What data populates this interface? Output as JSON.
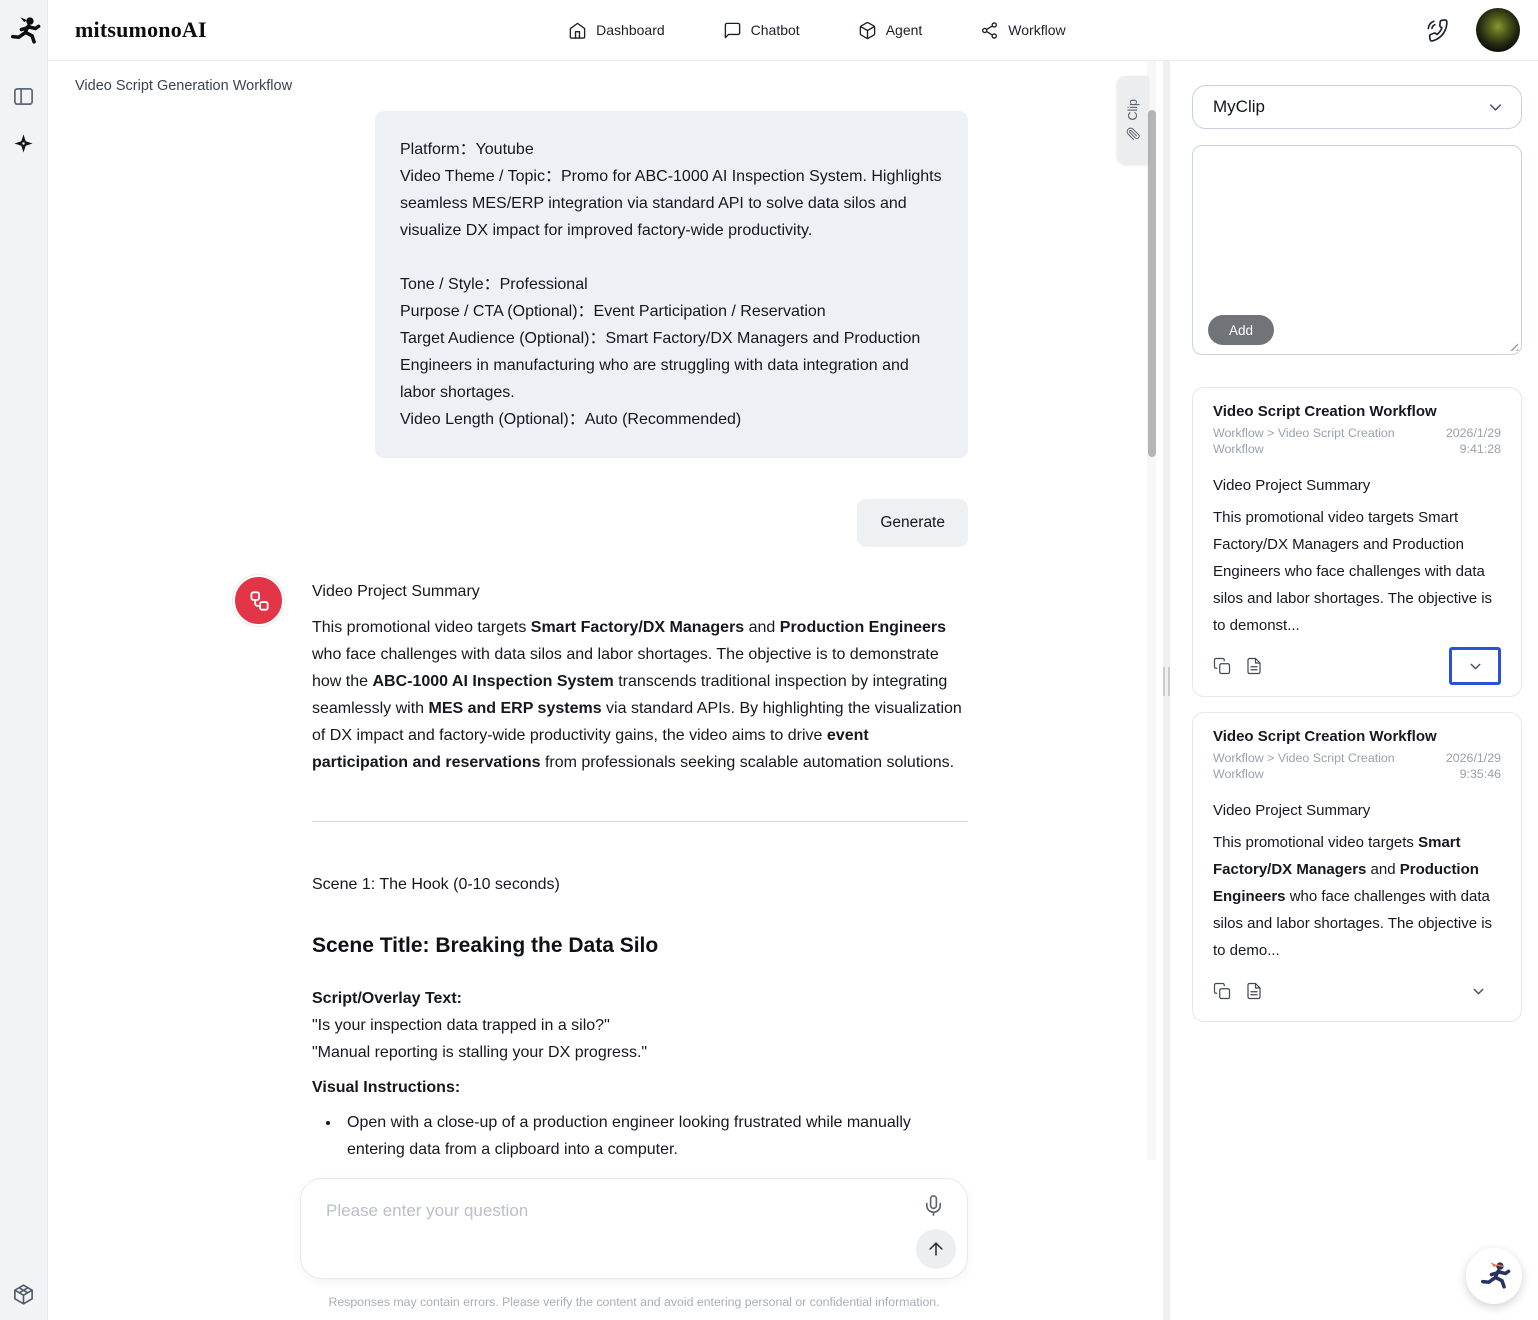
{
  "brand": {
    "name": "mitsumonoAI"
  },
  "nav": {
    "items": [
      {
        "label": "Dashboard",
        "icon": "home-icon"
      },
      {
        "label": "Chatbot",
        "icon": "chat-bubble-icon"
      },
      {
        "label": "Agent",
        "icon": "package-box-icon"
      },
      {
        "label": "Workflow",
        "icon": "share-nodes-icon"
      }
    ]
  },
  "main": {
    "page_title": "Video Script Generation Workflow",
    "user_message": "Platform：Youtube\nVideo Theme / Topic：Promo for ABC-1000 AI Inspection System. Highlights seamless MES/ERP integration via standard API to solve data silos and visualize DX impact for improved factory-wide productivity.\n\nTone / Style：Professional\nPurpose / CTA (Optional)：Event Participation / Reservation\nTarget Audience (Optional)：Smart Factory/DX Managers and Production Engineers in manufacturing who are struggling with data integration and labor shortages.\nVideo Length (Optional)：Auto (Recommended)",
    "generate_label": "Generate",
    "assistant": {
      "summary_title": "Video Project Summary",
      "summary_segments": [
        {
          "t": "This promotional video targets "
        },
        {
          "t": "Smart Factory/DX Managers",
          "b": true
        },
        {
          "t": " and "
        },
        {
          "t": "Production Engineers",
          "b": true
        },
        {
          "t": " who face challenges with data silos and labor shortages. The objective is to demonstrate how the "
        },
        {
          "t": "ABC-1000 AI Inspection System",
          "b": true
        },
        {
          "t": " transcends traditional inspection by integrating seamlessly with "
        },
        {
          "t": "MES and ERP systems",
          "b": true
        },
        {
          "t": " via standard APIs. By highlighting the visualization of DX impact and factory-wide productivity gains, the video aims to drive "
        },
        {
          "t": "event participation and reservations",
          "b": true
        },
        {
          "t": " from professionals seeking scalable automation solutions."
        }
      ],
      "scene_label": "Scene 1: The Hook (0-10 seconds)",
      "scene_title": "Scene Title: Breaking the Data Silo",
      "script_overlay_label": "Script/Overlay Text:",
      "script_lines": [
        "\"Is your inspection data trapped in a silo?\"",
        "\"Manual reporting is stalling your DX progress.\""
      ],
      "visual_label": "Visual Instructions:",
      "visual_bullets": [
        "Open with a close-up of a production engineer looking frustrated while manually entering data from a clipboard into a computer."
      ]
    },
    "input": {
      "placeholder": "Please enter your question"
    },
    "disclaimer": "Responses may contain errors. Please verify the content and avoid entering personal or confidential information."
  },
  "clip_panel": {
    "tab_label": "Clip",
    "collection_selected": "MyClip",
    "add_label": "Add",
    "cards": [
      {
        "title": "Video Script Creation Workflow",
        "breadcrumb": "Workflow > Video Script Creation Workflow",
        "date": "2026/1/29",
        "time": "9:41:28",
        "body_title": "Video Project Summary",
        "body_segments": [
          {
            "t": "This promotional video targets Smart Factory/DX Managers and Production Engineers who face challenges with data silos and labor shortages. The objective is to demonst..."
          }
        ]
      },
      {
        "title": "Video Script Creation Workflow",
        "breadcrumb": "Workflow > Video Script Creation Workflow",
        "date": "2026/1/29",
        "time": "9:35:46",
        "body_title": "Video Project Summary",
        "body_segments": [
          {
            "t": "This promotional video targets "
          },
          {
            "t": "Smart Factory/DX Managers",
            "b": true
          },
          {
            "t": " and "
          },
          {
            "t": "Production Engineers",
            "b": true
          },
          {
            "t": " who face challenges with data silos and labor shortages. The objective is to demo..."
          }
        ]
      }
    ]
  },
  "icons": {
    "brand-logo-icon": "ninja-silhouette",
    "panel-toggle-icon": "split-rectangle",
    "sparkle-icon": "✦",
    "cube-icon": "wireframe-cube",
    "home-icon": "⌂",
    "chat-bubble-icon": "🗨",
    "package-box-icon": "📦",
    "share-nodes-icon": "share-2",
    "phone-icon": "✆",
    "paperclip-icon": "📎",
    "mic-icon": "🎤",
    "send-icon": "↑",
    "copy-icon": "⧉",
    "file-text-icon": "🗎",
    "chevron-down-icon": "⌄",
    "assistant-avatar-icon": "workflow-nodes",
    "ninja-fab-icon": "ninja-mascot"
  },
  "colors": {
    "assistant_avatar_red": "#e23648",
    "focus_blue": "#2c51d8",
    "user_bubble_bg": "#edf0f4",
    "add_button_bg": "#707478",
    "rail_bg": "#f1f3f5",
    "fab_ninja_navy": "#273263",
    "fab_scarf_orange": "#e8732a"
  }
}
